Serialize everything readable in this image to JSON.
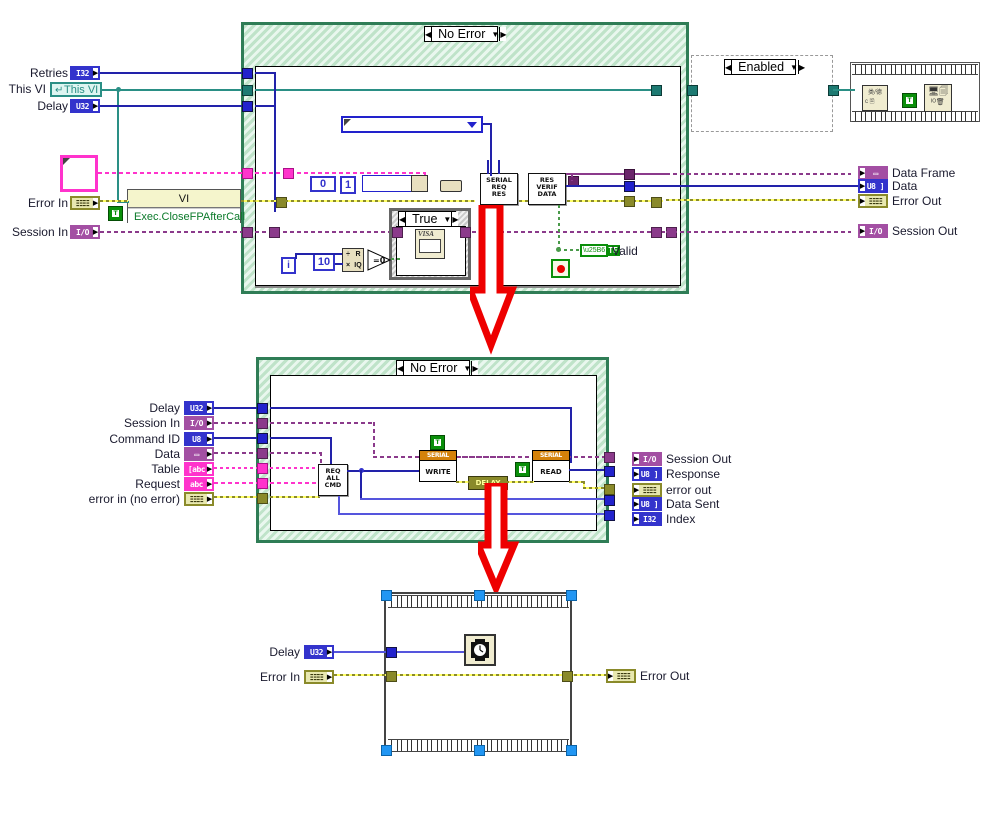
{
  "meta": {
    "app": "LabVIEW Block Diagram",
    "diagram_count": 3
  },
  "top_diagram": {
    "name": "serial-request-response-vi",
    "case_selector": {
      "label": "No Error",
      "left_arrow": "◀",
      "right_arrow": "▶",
      "dropdown": "▼"
    },
    "inputs": [
      {
        "label": "Retries",
        "type": "I32",
        "nub": "▶"
      },
      {
        "label": "This VI",
        "type": "This VI",
        "nub": ""
      },
      {
        "label": "Delay",
        "type": "U32",
        "nub": "▶"
      },
      {
        "label": "Error In",
        "type": "☷☷",
        "nub": "▶"
      },
      {
        "label": "Session In",
        "type": "I/O",
        "nub": "▶"
      }
    ],
    "outputs": [
      {
        "label": "Data Frame",
        "type": "▭",
        "nub": "▶"
      },
      {
        "label": "Data",
        "type": "U8 ]",
        "nub": "▶"
      },
      {
        "label": "Error Out",
        "type": "☷☷",
        "nub": "▶"
      },
      {
        "label": "Session Out",
        "type": "I/O",
        "nub": "▶"
      }
    ],
    "property_node": {
      "title": "VI",
      "property": "Exec.CloseFPAfterCall",
      "badge": "T"
    },
    "nodes": [
      {
        "name": "serial-req-res",
        "lines": [
          "SERIAL",
          "REQ",
          "RES"
        ]
      },
      {
        "name": "res-verif-data",
        "lines": [
          "RES",
          "VERIF",
          "DATA"
        ]
      }
    ],
    "constants": {
      "zero": "0",
      "one": "1",
      "ten": "10",
      "loop_index": "i"
    },
    "quotient_remainder": {
      "top_left": "÷",
      "top_right": "R",
      "bottom_left": "×",
      "bottom_right": "IQ"
    },
    "comparison": {
      "label": "=0"
    },
    "inner_case": {
      "label": "True",
      "left_arrow": "◀",
      "right_arrow": "▶",
      "dropdown": "▼"
    },
    "visa_node": {
      "label": "VISA"
    },
    "valid_indicator": {
      "label": "Valid",
      "type": "TF"
    },
    "stop_button": {
      "name": "stop-button"
    },
    "disable_structure": {
      "label": "Enabled",
      "left_arrow": "◀",
      "right_arrow": "▶",
      "dropdown": "▼"
    },
    "combo_box": {
      "value": ""
    }
  },
  "middle_diagram": {
    "name": "serial-write-read-vi",
    "case_selector": {
      "label": "No Error",
      "left_arrow": "◀",
      "right_arrow": "▶",
      "dropdown": "▼"
    },
    "inputs": [
      {
        "label": "Delay",
        "type": "U32",
        "nub": "▶"
      },
      {
        "label": "Session In",
        "type": "I/O",
        "nub": "▶"
      },
      {
        "label": "Command ID",
        "type": "U8",
        "nub": "▶"
      },
      {
        "label": "Data",
        "type": "▭",
        "nub": "▶"
      },
      {
        "label": "Table",
        "type": "[abc",
        "nub": "▶"
      },
      {
        "label": "Request",
        "type": "abc",
        "nub": "▶"
      },
      {
        "label": "error in (no error)",
        "type": "☷☷",
        "nub": "▶"
      }
    ],
    "outputs": [
      {
        "label": "Session Out",
        "type": "I/O",
        "nub": "▶"
      },
      {
        "label": "Response",
        "type": "U8 ]",
        "nub": "▶"
      },
      {
        "label": "error out",
        "type": "☷☷",
        "nub": "▶"
      },
      {
        "label": "Data Sent",
        "type": "U8 ]",
        "nub": "▶"
      },
      {
        "label": "Index",
        "type": "I32",
        "nub": "▶"
      }
    ],
    "nodes": [
      {
        "name": "req-all-cmd",
        "lines": [
          "REQ",
          "ALL",
          "CMD"
        ]
      },
      {
        "name": "serial-write",
        "header": "SERIAL",
        "body": "WRITE",
        "badge": "T"
      },
      {
        "name": "delay-subvi",
        "body": "DELAY"
      },
      {
        "name": "serial-read",
        "header": "SERIAL",
        "body": "READ",
        "badge": "T"
      }
    ]
  },
  "bottom_diagram": {
    "name": "delay-vi",
    "inputs": [
      {
        "label": "Delay",
        "type": "U32",
        "nub": "▶"
      },
      {
        "label": "Error In",
        "type": "☷☷",
        "nub": "▶"
      }
    ],
    "outputs": [
      {
        "label": "Error Out",
        "type": "☷☷",
        "nub": "▶"
      }
    ],
    "node": {
      "name": "wait-ms-timer-icon"
    }
  },
  "colors": {
    "case_border": "#2f7d56",
    "error_wire": "#ffff66",
    "error_wire_dark": "#8a8a2a",
    "io_wire": "#8b3a8b",
    "numeric_wire": "#3333cc",
    "refnum_wire": "#2a8f85",
    "string_wire": "#ff33cc",
    "arrow_red": "#ee0000",
    "subvi_header": "#d4820a",
    "badge_green": "#0a8f0a"
  }
}
